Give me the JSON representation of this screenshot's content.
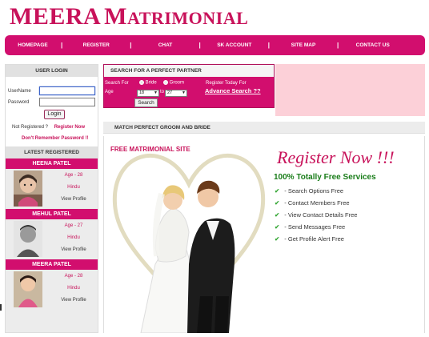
{
  "logo": {
    "first": "MEERA",
    "second_initial": "M",
    "second_rest": "ATRIMONIAL"
  },
  "nav": [
    "HOMEPAGE",
    "REGISTER",
    "CHAT",
    "SK ACCOUNT",
    "SITE MAP",
    "CONTACT US"
  ],
  "login": {
    "title": "USER LOGIN",
    "username_label": "UserName",
    "password_label": "Password",
    "username_value": "",
    "password_value": "",
    "button": "Login",
    "not_registered": "Not Registered ?",
    "register_now": "Register Now",
    "forgot": "Don't Remember Password !!"
  },
  "latest": {
    "title": "LATEST REGISTERED",
    "profiles": [
      {
        "name": "HEENA PATEL",
        "age": "Age - 28",
        "religion": "Hindu",
        "view": "View Profile"
      },
      {
        "name": "MEHUL PATEL",
        "age": "Age - 27",
        "religion": "Hindu",
        "view": "View Profile"
      },
      {
        "name": "MEERA PATEL",
        "age": "Age - 28",
        "religion": "Hindu",
        "view": "View Profile"
      }
    ]
  },
  "search": {
    "title": "SEARCH FOR A PERFECT PARTNER",
    "search_for": "Search For",
    "age": "Age",
    "bride": "Bride",
    "groom": "Groom",
    "age_from": "18",
    "to": "to",
    "age_to": "27",
    "button": "Search",
    "register_today": "Register Today For",
    "advance": "Advance Search ??"
  },
  "match_title": "MATCH PERFECT GROOM AND BRIDE",
  "banner": {
    "free_matrimonial": "FREE MATRIMONIAL SITE",
    "register_now": "Register Now !!!",
    "free_services": "100% Totally Free Services",
    "features": [
      "- Search Options Free",
      "- Contact Members Free",
      "- View Contact Details Free",
      "- Send Messages Free",
      "- Get Profile Alert Free"
    ]
  },
  "colors": {
    "brand": "#d20e6e",
    "logo": "#c8125a",
    "pink_area": "#fcd0d8",
    "check": "#38a838"
  }
}
